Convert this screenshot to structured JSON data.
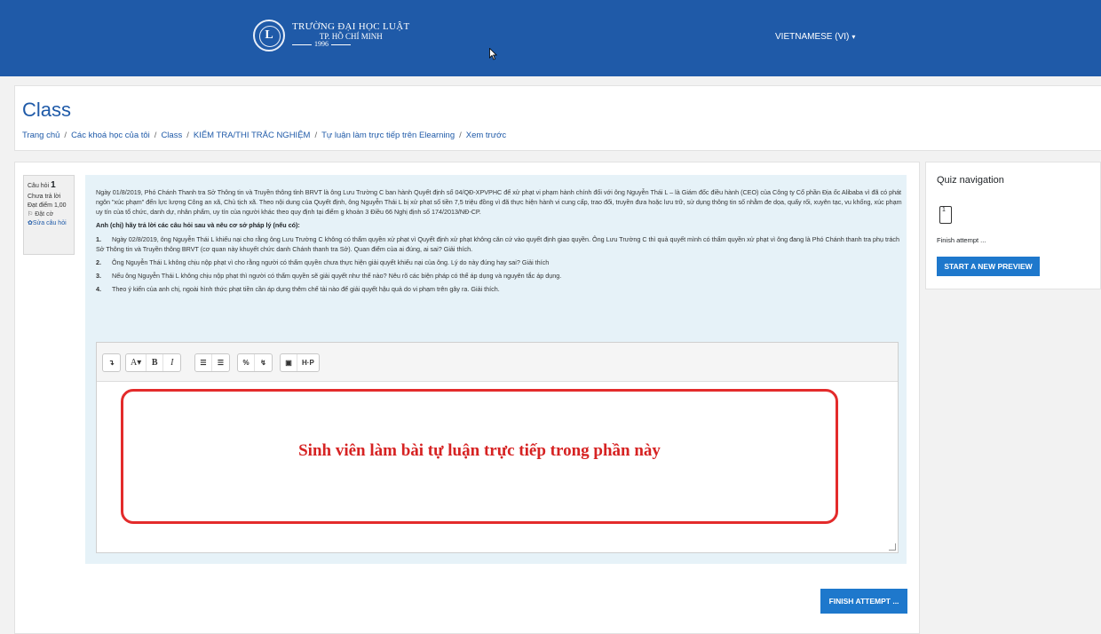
{
  "header": {
    "logo": {
      "monogram": "L",
      "line1": "TRƯỜNG ĐẠI HỌC LUẬT",
      "line2": "TP. HỒ CHÍ MINH",
      "year": "1996"
    },
    "language": "VIETNAMESE (VI)"
  },
  "page": {
    "title": "Class",
    "breadcrumb": [
      "Trang chủ",
      "Các khoá học của tôi",
      "Class",
      "KIỂM TRA/THI TRẮC NGHIỆM",
      "Tự luận làm trực tiếp trên Elearning",
      "Xem trước"
    ]
  },
  "question_info": {
    "label": "Câu hỏi",
    "number": "1",
    "status": "Chưa trả lời",
    "mark": "Đạt điểm 1,00",
    "flag": "Đặt cờ",
    "edit": "Sửa câu hỏi"
  },
  "question": {
    "intro": "Ngày 01/8/2019, Phó Chánh Thanh tra Sở Thông tin và Truyền thông tỉnh BRVT là ông Lưu Trường C ban hành Quyết định số 04/QĐ-XPVPHC để xử phạt vi phạm hành chính đối với ông Nguyễn Thái L – là Giám đốc điều hành (CEO) của Công ty Cổ phần Địa ốc Alibaba vì đã có phát ngôn \"xúc phạm\" đến lực lượng Công an xã, Chủ tịch xã. Theo nội dung của Quyết định, ông Nguyễn Thái L bị xử phạt số tiền 7,5 triệu đồng vì đã thực hiện hành vi cung cấp, trao đổi, truyền đưa hoặc lưu trữ, sử dụng thông tin số nhằm đe dọa, quấy rối, xuyên tạc, vu khống, xúc phạm uy tín của tổ chức, danh dự, nhân phẩm, uy tín của người khác theo quy định tại điểm g khoản 3 Điều 66 Nghị định số 174/2013/NĐ-CP.",
    "prompt": "Anh (chị) hãy trả lời các câu hỏi sau và nêu cơ sở pháp lý (nếu có):",
    "items": [
      {
        "num": "1.",
        "text": "Ngày 02/8/2019, ông Nguyễn Thái L khiếu nại cho rằng ông Lưu Trường C không có thẩm quyền xử phạt vì Quyết định xử phạt không căn cứ vào quyết định giao quyền. Ông Lưu Trường C thì quả quyết mình có thẩm quyền xử phạt vì ông đang là Phó Chánh thanh tra phụ trách Sở Thông tin và Truyền thông BRVT (cơ quan này khuyết chức danh Chánh thanh tra Sở). Quan điểm của ai đúng, ai sai? Giải thích."
      },
      {
        "num": "2.",
        "text": "Ông Nguyễn Thái L không chịu nộp phạt vì cho rằng người có thẩm quyền chưa thực hiện giải quyết khiếu nại của ông. Lý do này đúng hay sai? Giải thích"
      },
      {
        "num": "3.",
        "text": "Nếu ông Nguyễn Thái L không chịu nộp phạt thì người có thẩm quyền sẽ giải quyết như thế nào? Nêu rõ các biện pháp có thể áp dụng và nguyên tắc áp dụng."
      },
      {
        "num": "4.",
        "text": "Theo ý kiến của anh chị, ngoài hình thức phạt tiền cần áp dụng thêm chế tài nào để giải quyết hậu quả do vi phạm trên gây ra. Giải thích."
      }
    ]
  },
  "editor": {
    "toolbar": {
      "expand": "↴",
      "font": "A▾",
      "bold": "B",
      "italic": "I",
      "unordered_list": "☰",
      "ordered_list": "☰",
      "link": "%",
      "unlink": "↯",
      "image": "▣",
      "h5p": "H·P"
    },
    "hint": "Sinh viên làm bài tự luận trực tiếp trong phần này"
  },
  "actions": {
    "finish": "FINISH ATTEMPT ..."
  },
  "quiz_nav": {
    "title": "Quiz navigation",
    "question_number": "1",
    "finish_link": "Finish attempt ...",
    "start_preview": "START A NEW PREVIEW"
  },
  "colors": {
    "navbar": "#1f5aa8",
    "primary_button": "#1e78cc",
    "question_bg": "#e6f2f8",
    "annotation_red": "#e32b2b"
  }
}
